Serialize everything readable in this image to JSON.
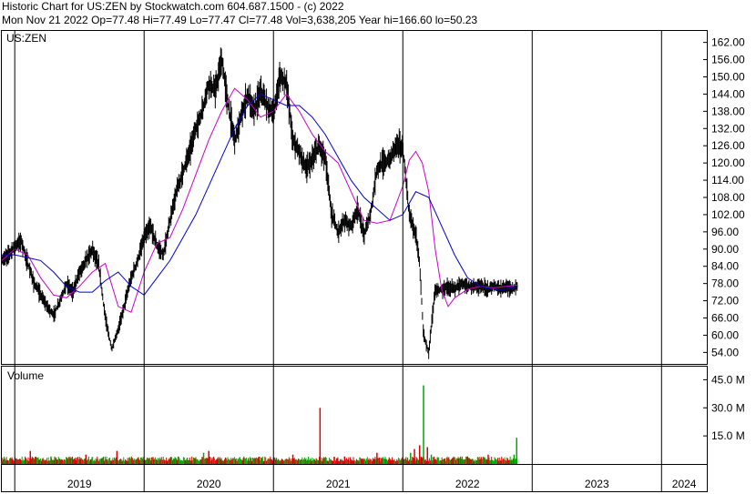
{
  "header": {
    "line1": "Historic Chart for US:ZEN  by Stockwatch.com 604.687.1500 - (c) 2022",
    "line2": "Mon Nov 21 2022   Op=77.48  Hi=77.49  Lo=77.47  Cl=77.48  Vol=3,638,205   Year hi=166.60  lo=50.23"
  },
  "colors": {
    "price": "#000000",
    "ma_short": "#cc00cc",
    "ma_long": "#0000cc",
    "vol_up": "#00aa00",
    "vol_down": "#dd0000",
    "grid": "#000000",
    "background": "#ffffff"
  },
  "chart_data": [
    {
      "type": "line",
      "panel": "price",
      "title": "US:ZEN",
      "yticks": [
        "162.00",
        "156.00",
        "150.00",
        "144.00",
        "138.00",
        "132.00",
        "126.00",
        "120.00",
        "114.00",
        "108.00",
        "102.00",
        "96.00",
        "90.00",
        "84.00",
        "78.00",
        "72.00",
        "66.00",
        "60.00",
        "54.00"
      ],
      "ylim": [
        50,
        166
      ],
      "xlim": [
        2018.9,
        2024.35
      ],
      "xticks": [
        "2019",
        "2020",
        "2021",
        "2022",
        "2023",
        "2024"
      ],
      "series": [
        {
          "role": "price",
          "x": [
            2018.9,
            2018.95,
            2019.0,
            2019.05,
            2019.1,
            2019.15,
            2019.2,
            2019.25,
            2019.3,
            2019.35,
            2019.4,
            2019.45,
            2019.5,
            2019.55,
            2019.6,
            2019.65,
            2019.7,
            2019.75,
            2019.8,
            2019.85,
            2019.9,
            2019.95,
            2020.0,
            2020.05,
            2020.1,
            2020.15,
            2020.2,
            2020.25,
            2020.3,
            2020.35,
            2020.4,
            2020.45,
            2020.5,
            2020.55,
            2020.6,
            2020.65,
            2020.7,
            2020.75,
            2020.8,
            2020.85,
            2020.9,
            2020.95,
            2021.0,
            2021.05,
            2021.1,
            2021.15,
            2021.2,
            2021.25,
            2021.3,
            2021.35,
            2021.4,
            2021.45,
            2021.5,
            2021.55,
            2021.6,
            2021.65,
            2021.7,
            2021.75,
            2021.8,
            2021.85,
            2021.9,
            2021.95,
            2022.0,
            2022.05,
            2022.1,
            2022.13,
            2022.16,
            2022.2,
            2022.25,
            2022.3,
            2022.35,
            2022.4,
            2022.45,
            2022.5,
            2022.55,
            2022.6,
            2022.65,
            2022.7,
            2022.75,
            2022.8,
            2022.85,
            2022.89
          ],
          "values": [
            86,
            88,
            91,
            93,
            85,
            78,
            74,
            70,
            67,
            72,
            78,
            75,
            82,
            86,
            90,
            84,
            66,
            55,
            62,
            71,
            80,
            86,
            94,
            98,
            91,
            88,
            100,
            110,
            117,
            124,
            132,
            138,
            148,
            145,
            156,
            140,
            128,
            136,
            144,
            138,
            145,
            140,
            137,
            150,
            148,
            128,
            124,
            118,
            121,
            126,
            122,
            102,
            96,
            100,
            98,
            104,
            95,
            102,
            118,
            120,
            121,
            127,
            125,
            102,
            95,
            85,
            60,
            54,
            76,
            76,
            77,
            76,
            78,
            77,
            77,
            77,
            76,
            77,
            76,
            77,
            76,
            77.5
          ]
        },
        {
          "role": "ma_short",
          "x": [
            2018.9,
            2019.0,
            2019.1,
            2019.2,
            2019.3,
            2019.4,
            2019.5,
            2019.6,
            2019.7,
            2019.8,
            2019.9,
            2020.0,
            2020.1,
            2020.2,
            2020.3,
            2020.4,
            2020.5,
            2020.6,
            2020.7,
            2020.8,
            2020.9,
            2021.0,
            2021.1,
            2021.2,
            2021.3,
            2021.4,
            2021.5,
            2021.6,
            2021.7,
            2021.8,
            2021.9,
            2022.0,
            2022.05,
            2022.1,
            2022.15,
            2022.2,
            2022.25,
            2022.3,
            2022.35,
            2022.4,
            2022.5,
            2022.6,
            2022.7,
            2022.8,
            2022.89
          ],
          "values": [
            86,
            90,
            88,
            80,
            74,
            73,
            77,
            82,
            85,
            70,
            68,
            82,
            92,
            94,
            104,
            116,
            128,
            138,
            146,
            142,
            136,
            138,
            144,
            138,
            130,
            124,
            120,
            110,
            100,
            99,
            100,
            112,
            121,
            124,
            120,
            110,
            90,
            76,
            70,
            73,
            76,
            77,
            76.5,
            77,
            77.5
          ]
        },
        {
          "role": "ma_long",
          "x": [
            2018.9,
            2019.0,
            2019.1,
            2019.2,
            2019.3,
            2019.4,
            2019.5,
            2019.6,
            2019.7,
            2019.8,
            2019.9,
            2020.0,
            2020.1,
            2020.2,
            2020.3,
            2020.4,
            2020.5,
            2020.6,
            2020.7,
            2020.8,
            2020.9,
            2021.0,
            2021.1,
            2021.2,
            2021.3,
            2021.4,
            2021.5,
            2021.6,
            2021.7,
            2021.8,
            2021.9,
            2022.0,
            2022.1,
            2022.2,
            2022.3,
            2022.4,
            2022.5,
            2022.6,
            2022.7,
            2022.8,
            2022.89
          ],
          "values": [
            88,
            88,
            87,
            86,
            82,
            77,
            75,
            75,
            79,
            82,
            77,
            74,
            80,
            86,
            94,
            102,
            112,
            122,
            132,
            140,
            144,
            142,
            140,
            140,
            136,
            130,
            122,
            114,
            108,
            104,
            100,
            102,
            110,
            108,
            98,
            88,
            80,
            77,
            76,
            76,
            77
          ]
        }
      ]
    },
    {
      "type": "bar",
      "panel": "volume",
      "title": "Volume",
      "yticks": [
        "45.0 M",
        "30.0 M",
        "15.0 M"
      ],
      "ylim": [
        0,
        52
      ],
      "xlim": [
        2018.9,
        2024.35
      ],
      "spikes": [
        {
          "x": 2019.12,
          "value": 7,
          "dir": "down"
        },
        {
          "x": 2019.28,
          "value": 4,
          "dir": "up"
        },
        {
          "x": 2019.55,
          "value": 5,
          "dir": "down"
        },
        {
          "x": 2019.79,
          "value": 7,
          "dir": "down"
        },
        {
          "x": 2020.46,
          "value": 6,
          "dir": "up"
        },
        {
          "x": 2020.5,
          "value": 7,
          "dir": "down"
        },
        {
          "x": 2021.15,
          "value": 5,
          "dir": "down"
        },
        {
          "x": 2021.36,
          "value": 30,
          "dir": "down"
        },
        {
          "x": 2021.55,
          "value": 4,
          "dir": "down"
        },
        {
          "x": 2021.8,
          "value": 6,
          "dir": "down"
        },
        {
          "x": 2022.06,
          "value": 6,
          "dir": "up"
        },
        {
          "x": 2022.09,
          "value": 8,
          "dir": "down"
        },
        {
          "x": 2022.13,
          "value": 10,
          "dir": "down"
        },
        {
          "x": 2022.16,
          "value": 42,
          "dir": "up"
        },
        {
          "x": 2022.19,
          "value": 9,
          "dir": "down"
        },
        {
          "x": 2022.22,
          "value": 5,
          "dir": "up"
        },
        {
          "x": 2022.5,
          "value": 4,
          "dir": "down"
        },
        {
          "x": 2022.66,
          "value": 5,
          "dir": "down"
        },
        {
          "x": 2022.86,
          "value": 5,
          "dir": "up"
        },
        {
          "x": 2022.88,
          "value": 14,
          "dir": "up"
        }
      ]
    }
  ]
}
